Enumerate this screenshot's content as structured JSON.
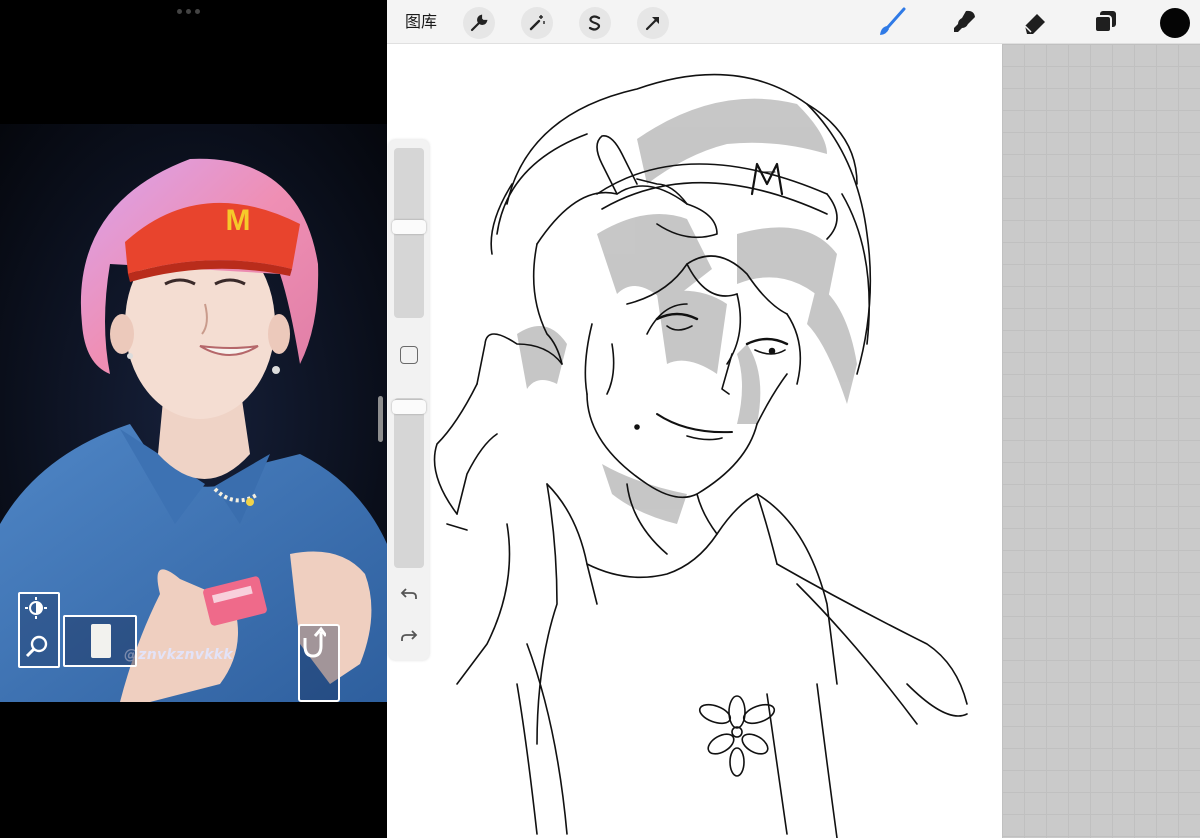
{
  "left_pane": {
    "watermark": "@znvkznvkkk",
    "visor_logo": "M",
    "controls": {
      "brightness_icon": "sun-half-icon",
      "zoom_icon": "magnifier-icon",
      "undo_icon": "undo-arrow-icon"
    }
  },
  "drawing_app": {
    "toolbar": {
      "gallery_label": "图库",
      "left_tools": [
        "wrench-icon",
        "magic-wand-icon",
        "selection-s-icon",
        "transform-arrow-icon"
      ],
      "right_tools": [
        "brush-icon",
        "smudge-icon",
        "eraser-icon",
        "layers-icon"
      ],
      "active_tool": "brush",
      "current_color": "#050505",
      "accent_color": "#2f7ae6"
    },
    "sidebar": {
      "icons": [
        "modify-square-icon",
        "undo-icon",
        "redo-icon"
      ]
    },
    "sketch": {
      "shirt_motif": "flower",
      "cap_logo": "M"
    }
  }
}
